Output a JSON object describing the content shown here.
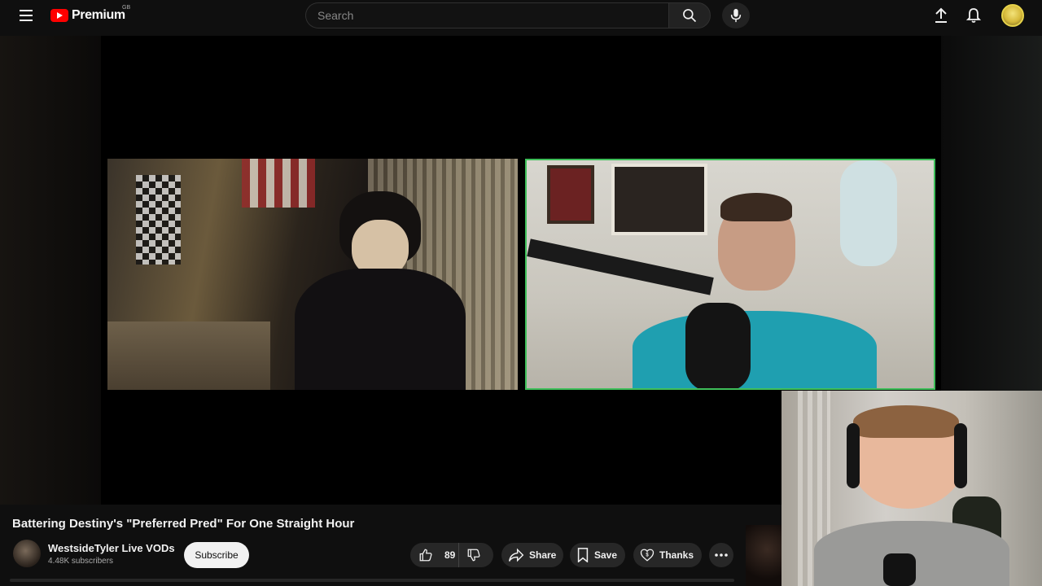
{
  "header": {
    "logo_text": "Premium",
    "logo_region": "GB",
    "search_placeholder": "Search",
    "icons": [
      "menu-icon",
      "search-icon",
      "mic-icon",
      "upload-icon",
      "bell-icon"
    ],
    "accent_color": "#ff0000"
  },
  "video": {
    "title": "Battering Destiny's \"Preferred Pred\" For One Straight Hour"
  },
  "channel": {
    "name": "WestsideTyler Live VODs",
    "subscribers": "4.48K subscribers",
    "subscribe_label": "Subscribe"
  },
  "actions": {
    "like_count": "89",
    "share_label": "Share",
    "save_label": "Save",
    "thanks_label": "Thanks"
  }
}
